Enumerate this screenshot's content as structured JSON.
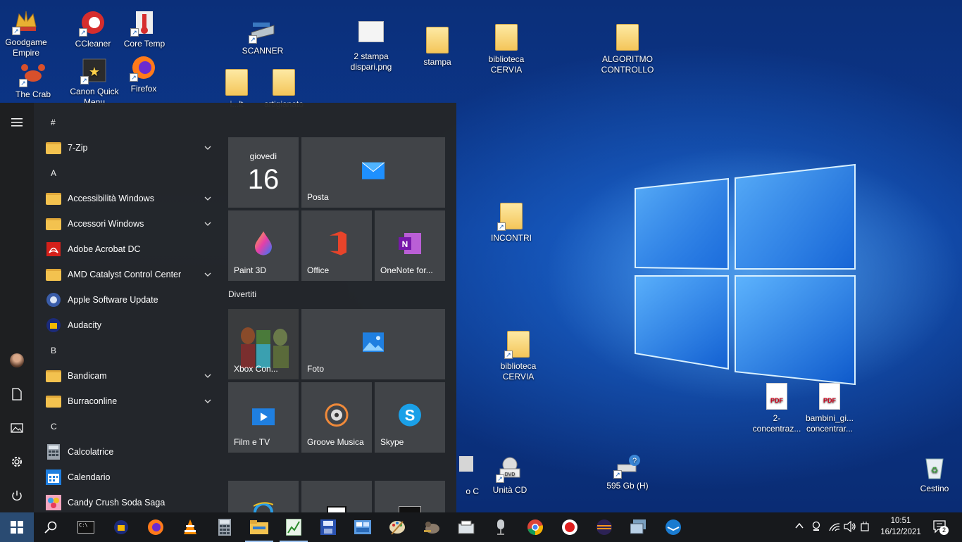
{
  "desktop": {
    "icons": [
      {
        "id": "goodgame",
        "label": "Goodgame\nEmpire"
      },
      {
        "id": "ccleaner",
        "label": "CCleaner"
      },
      {
        "id": "coretemp",
        "label": "Core Temp"
      },
      {
        "id": "scanner",
        "label": "SCANNER"
      },
      {
        "id": "stampa-dispari",
        "label": "2 stampa\ndispari.png"
      },
      {
        "id": "stampa",
        "label": "stampa"
      },
      {
        "id": "biblioteca1",
        "label": "biblioteca\nCERVIA"
      },
      {
        "id": "algoritmo",
        "label": "ALGORITMO\nCONTROLLO"
      },
      {
        "id": "thecrab",
        "label": "The Crab"
      },
      {
        "id": "canon",
        "label": "Canon Quick\nMenu"
      },
      {
        "id": "firefox",
        "label": "Firefox"
      },
      {
        "id": "incontri",
        "label": "INCONTRI"
      },
      {
        "id": "biblioteca2",
        "label": "biblioteca\nCERVIA"
      },
      {
        "id": "pdf1",
        "label": "2-\nconcentraz..."
      },
      {
        "id": "pdf2",
        "label": "bambini_gi...\nconcentrar..."
      },
      {
        "id": "co-c",
        "label": "o C"
      },
      {
        "id": "unita-cd",
        "label": "Unità CD"
      },
      {
        "id": "drive595",
        "label": "595 Gb (H)"
      },
      {
        "id": "cestino",
        "label": "Cestino"
      },
      {
        "id": "hidden1",
        "label": "i...lt"
      },
      {
        "id": "artigianato",
        "label": "artigianato"
      }
    ]
  },
  "start_menu": {
    "app_list": [
      {
        "type": "letter",
        "label": "#"
      },
      {
        "type": "folder",
        "label": "7-Zip",
        "expand": true
      },
      {
        "type": "letter",
        "label": "A"
      },
      {
        "type": "folder",
        "label": "Accessibilità Windows",
        "expand": true
      },
      {
        "type": "folder",
        "label": "Accessori Windows",
        "expand": true
      },
      {
        "type": "app",
        "label": "Adobe Acrobat DC",
        "icon": "acrobat-icon"
      },
      {
        "type": "folder",
        "label": "AMD Catalyst Control Center",
        "expand": true
      },
      {
        "type": "app",
        "label": "Apple Software Update",
        "icon": "apple-update-icon"
      },
      {
        "type": "app",
        "label": "Audacity",
        "icon": "audacity-icon"
      },
      {
        "type": "letter",
        "label": "B"
      },
      {
        "type": "folder",
        "label": "Bandicam",
        "expand": true
      },
      {
        "type": "folder",
        "label": "Burraconline",
        "expand": true
      },
      {
        "type": "letter",
        "label": "C"
      },
      {
        "type": "app",
        "label": "Calcolatrice",
        "icon": "calculator-icon"
      },
      {
        "type": "app",
        "label": "Calendario",
        "icon": "calendar-icon"
      },
      {
        "type": "app",
        "label": "Candy Crush Soda Saga",
        "icon": "candy-crush-icon"
      }
    ],
    "tiles": {
      "calendar_day": "giovedì",
      "calendar_date": "16",
      "posta": "Posta",
      "paint3d": "Paint 3D",
      "office": "Office",
      "onenote": "OneNote for...",
      "group_divertiti": "Divertiti",
      "xbox": "Xbox Con...",
      "foto": "Foto",
      "film": "Film e TV",
      "groove": "Groove Musica",
      "skype": "Skype"
    }
  },
  "taskbar": {
    "time": "10:51",
    "date": "16/12/2021",
    "notifications": "2"
  },
  "colors": {
    "accent": "#2a4b72",
    "start_bg": "#242628",
    "tile_bg": "#464a4e"
  }
}
